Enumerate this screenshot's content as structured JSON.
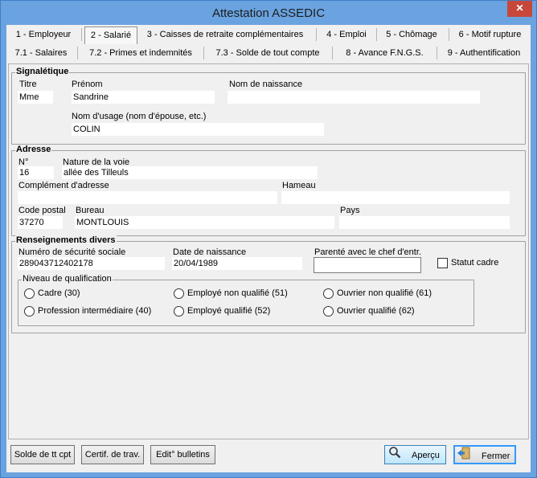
{
  "window": {
    "title": "Attestation ASSEDIC",
    "close_glyph": "✕"
  },
  "tabs_row1": [
    {
      "label": "1 - Employeur"
    },
    {
      "label": "2 - Salarié",
      "selected": true
    },
    {
      "label": "3 - Caisses de retraite complémentaires"
    },
    {
      "label": "4 - Emploi"
    },
    {
      "label": "5 - Chômage"
    },
    {
      "label": "6 - Motif rupture"
    }
  ],
  "tabs_row2": [
    {
      "label": "7.1 - Salaires"
    },
    {
      "label": "7.2 - Primes et indemnités"
    },
    {
      "label": "7.3 - Solde de tout compte"
    },
    {
      "label": "8 - Avance F.N.G.S."
    },
    {
      "label": "9 - Authentification"
    }
  ],
  "signaletique": {
    "title": "Signalétique",
    "titre_label": "Titre",
    "titre_value": "Mme",
    "prenom_label": "Prénom",
    "prenom_value": "Sandrine",
    "nom_naissance_label": "Nom de naissance",
    "nom_naissance_value": "",
    "nom_usage_label": "Nom d'usage (nom d'épouse, etc.)",
    "nom_usage_value": "COLIN"
  },
  "adresse": {
    "title": "Adresse",
    "numero_label": "N°",
    "numero_value": "16",
    "voie_label": "Nature de la voie",
    "voie_value": "allée des Tilleuls",
    "complement_label": "Complément d'adresse",
    "complement_value": "",
    "hameau_label": "Hameau",
    "hameau_value": "",
    "cp_label": "Code postal",
    "cp_value": "37270",
    "bureau_label": "Bureau",
    "bureau_value": "MONTLOUIS",
    "pays_label": "Pays",
    "pays_value": ""
  },
  "divers": {
    "title": "Renseignements divers",
    "secu_label": "Numéro de sécurité sociale",
    "secu_value": "289043712402178",
    "naissance_label": "Date de naissance",
    "naissance_value": "20/04/1989",
    "parente_label": "Parenté avec le chef d'entr.",
    "parente_value": "",
    "statut_cadre_label": "Statut cadre",
    "statut_cadre_checked": false,
    "qualif_title": "Niveau de qualification",
    "qualif_options": [
      "Cadre (30)",
      "Employé non qualifié (51)",
      "Ouvrier non qualifié (61)",
      "Profession intermédiaire (40)",
      "Employé qualifié (52)",
      "Ouvrier qualifié (62)"
    ]
  },
  "buttons": {
    "solde": "Solde de tt cpt",
    "certif": "Certif. de trav.",
    "edit": "Edit° bulletins",
    "apercu": "Aperçu",
    "fermer": "Fermer"
  },
  "icons": {
    "apercu": "magnifier-icon",
    "fermer": "exit-door-icon"
  }
}
